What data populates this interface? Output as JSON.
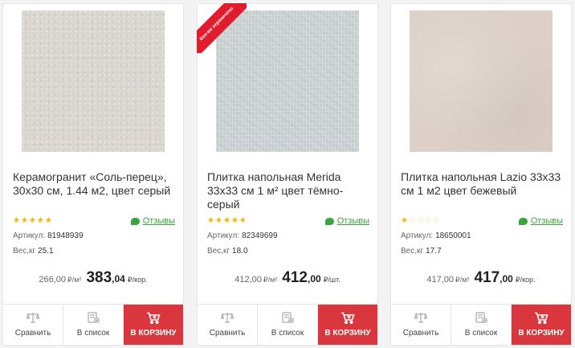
{
  "products": [
    {
      "title": "Керамогранит «Соль-перец», 30x30 см, 1.44 м2, цвет серый",
      "rating": 5,
      "reviews_label": "Отзывы",
      "sku_label": "Артикул:",
      "sku": "81948939",
      "weight_label": "Вес,кг",
      "weight": "25.1",
      "old_price": "266,00",
      "old_unit": "₽/м²",
      "price_int": "383",
      "price_frac": ",04",
      "price_unit": "₽/кор.",
      "compare_label": "Сравнить",
      "list_label": "В список",
      "cart_label": "В КОРЗИНУ"
    },
    {
      "badge": "Кол-во ограничено",
      "title": "Плитка напольная Merida 33x33 см 1 м² цвет тёмно-серый",
      "rating": 5,
      "reviews_label": "Отзывы",
      "sku_label": "Артикул:",
      "sku": "82349699",
      "weight_label": "Вес,кг",
      "weight": "18.0",
      "old_price": "412,00",
      "old_unit": "₽/м²",
      "price_int": "412",
      "price_frac": ",00",
      "price_unit": "₽/шт.",
      "compare_label": "Сравнить",
      "list_label": "В список",
      "cart_label": "В КОРЗИНУ"
    },
    {
      "title": "Плитка напольная Lazio 33x33 см 1 м2 цвет бежевый",
      "rating": 1,
      "reviews_label": "Отзывы",
      "sku_label": "Артикул:",
      "sku": "18650001",
      "weight_label": "Вес,кг",
      "weight": "17.7",
      "old_price": "417,00",
      "old_unit": "₽/м²",
      "price_int": "417",
      "price_frac": ",00",
      "price_unit": "₽/кор.",
      "compare_label": "Сравнить",
      "list_label": "В список",
      "cart_label": "В КОРЗИНУ"
    }
  ],
  "colors": {
    "accent": "#d9363e",
    "badge": "#e21b2d",
    "stars": "#f5b301",
    "reviews": "#3ba53b"
  }
}
